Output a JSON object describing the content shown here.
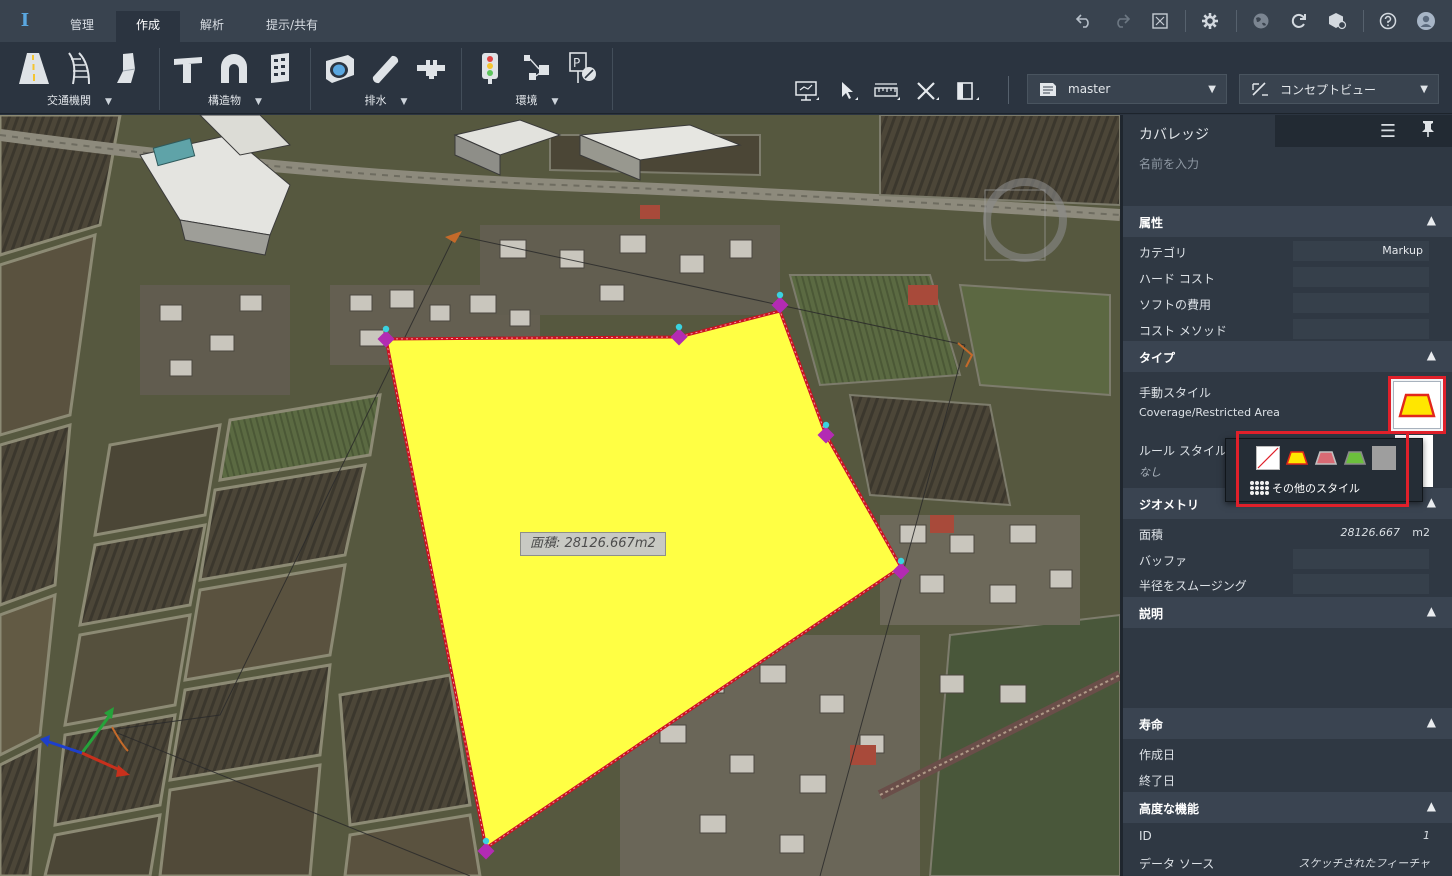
{
  "app": {
    "logo_letter": "I"
  },
  "menu": {
    "tabs": [
      {
        "label": "管理"
      },
      {
        "label": "作成"
      },
      {
        "label": "解析"
      },
      {
        "label": "提示/共有"
      }
    ],
    "active_tab": "作成"
  },
  "topbar_icons": [
    "undo-icon",
    "redo-icon",
    "fit-view-icon",
    "gear-icon",
    "globe-icon",
    "refresh-icon",
    "cube-settings-icon",
    "help-icon",
    "user-icon"
  ],
  "ribbon": {
    "groups": [
      {
        "label": "交通機関",
        "icons": [
          "road-icon",
          "rail-icon",
          "bridge-pier-icon"
        ]
      },
      {
        "label": "構造物",
        "icons": [
          "pier-icon",
          "tunnel-icon",
          "building-icon"
        ]
      },
      {
        "label": "排水",
        "icons": [
          "pond-icon",
          "pipe-icon",
          "coupling-icon"
        ]
      },
      {
        "label": "環境",
        "icons": [
          "traffic-light-icon",
          "interchange-icon",
          "parking-sign-icon"
        ]
      }
    ],
    "tools": [
      "presentation-tool-icon",
      "select-tool-icon",
      "measure-tool-icon",
      "trim-tool-icon",
      "panel-tool-icon"
    ],
    "proposal_select": {
      "value": "master"
    },
    "view_select": {
      "value": "コンセプトビュー"
    }
  },
  "viewport": {
    "area_label": "面積: 28126.667m2",
    "colors": {
      "fill": "#ffff44",
      "outline": "#cc1122",
      "vertex": "#b32bb3"
    }
  },
  "panel": {
    "title": "カバレッジ",
    "name_placeholder": "名前を入力",
    "sections": {
      "attributes": {
        "title": "属性",
        "rows": [
          {
            "label": "カテゴリ",
            "value": "Markup"
          },
          {
            "label": "ハード コスト",
            "value": ""
          },
          {
            "label": "ソフトの費用",
            "value": ""
          },
          {
            "label": "コスト メソッド",
            "value": ""
          }
        ]
      },
      "type": {
        "title": "タイプ",
        "manual_style_label": "手動スタイル",
        "manual_style_value": "Coverage/Restricted Area",
        "rule_style_label": "ルール スタイル",
        "rule_style_value": "なし"
      },
      "geometry": {
        "title": "ジオメトリ",
        "area_label": "面積",
        "area_value": "28126.667",
        "area_unit": "m2",
        "buffer_label": "バッファ",
        "smoothing_label": "半径をスムージング"
      },
      "description": {
        "title": "説明"
      },
      "lifecycle": {
        "title": "寿命",
        "created_label": "作成日",
        "ended_label": "終了日"
      },
      "advanced": {
        "title": "高度な機能",
        "id_label": "ID",
        "id_value": "1",
        "source_label": "データ ソース",
        "source_value": "スケッチされたフィーチャ"
      }
    }
  },
  "style_popup": {
    "swatches": [
      "none",
      "yellow",
      "pink",
      "green",
      "gray"
    ],
    "more_styles": "その他のスタイル"
  }
}
